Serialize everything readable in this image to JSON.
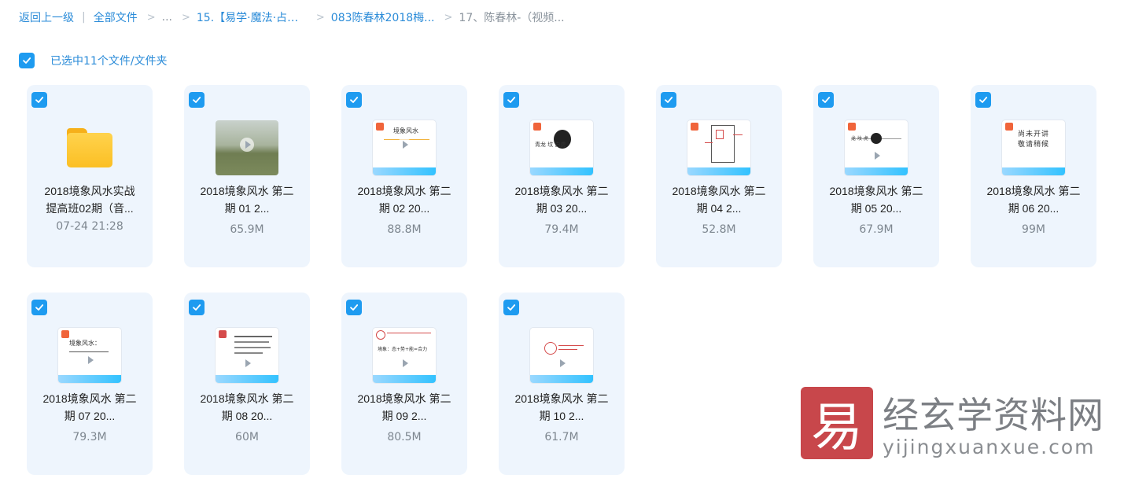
{
  "breadcrumb": {
    "back": "返回上一级",
    "all_files": "全部文件",
    "ellipsis": "...",
    "folder1": "15.【易学·魔法·占卜...",
    "folder2": "083陈春林2018梅...",
    "current": "17、陈春林-（视频..."
  },
  "selection": {
    "text": "已选中11个文件/文件夹",
    "checked": true
  },
  "files": [
    {
      "type": "folder",
      "name_line1": "2018境象风水实战",
      "name_line2": "提高班02期（音...",
      "meta": "07-24 21:28"
    },
    {
      "type": "video",
      "thumb": "photo",
      "name_line1": "2018境象风水 第二",
      "name_line2": "期 01 2...",
      "meta": "65.9M"
    },
    {
      "type": "video",
      "thumb": "title",
      "thumb_text": "境象风水",
      "name_line1": "2018境象风水 第二",
      "name_line2": "期 02 20...",
      "meta": "88.8M"
    },
    {
      "type": "video",
      "thumb": "circle",
      "thumb_text": "青龙 坟 白虎",
      "name_line1": "2018境象风水 第二",
      "name_line2": "期 03 20...",
      "meta": "79.4M"
    },
    {
      "type": "video",
      "thumb": "plan",
      "name_line1": "2018境象风水 第二",
      "name_line2": "期 04 2...",
      "meta": "52.8M"
    },
    {
      "type": "video",
      "thumb": "dot",
      "thumb_text": "龙 坟 虎",
      "name_line1": "2018境象风水 第二",
      "name_line2": "期 05 20...",
      "meta": "67.9M"
    },
    {
      "type": "video",
      "thumb": "text",
      "thumb_text": "尚未开讲 敬请稍候",
      "name_line1": "2018境象风水 第二",
      "name_line2": "期 06 20...",
      "meta": "99M"
    },
    {
      "type": "video",
      "thumb": "title2",
      "thumb_text": "境象风水：",
      "name_line1": "2018境象风水 第二",
      "name_line2": "期 07 20...",
      "meta": "79.3M"
    },
    {
      "type": "video",
      "thumb": "notes",
      "name_line1": "2018境象风水 第二",
      "name_line2": "期 08 20...",
      "meta": "60M"
    },
    {
      "type": "video",
      "thumb": "formula",
      "thumb_text": "境象：态+势+能=合力",
      "name_line1": "2018境象风水 第二",
      "name_line2": "期 09 2...",
      "meta": "80.5M"
    },
    {
      "type": "video",
      "thumb": "seal",
      "name_line1": "2018境象风水 第二",
      "name_line2": "期 10 2...",
      "meta": "61.7M"
    }
  ],
  "watermark": {
    "badge": "易",
    "title": "经玄学资料网",
    "url": "yijingxuanxue.com"
  },
  "colors": {
    "accent": "#1e9bf0",
    "link": "#2a8bd8",
    "card_bg": "#eef5fd"
  }
}
